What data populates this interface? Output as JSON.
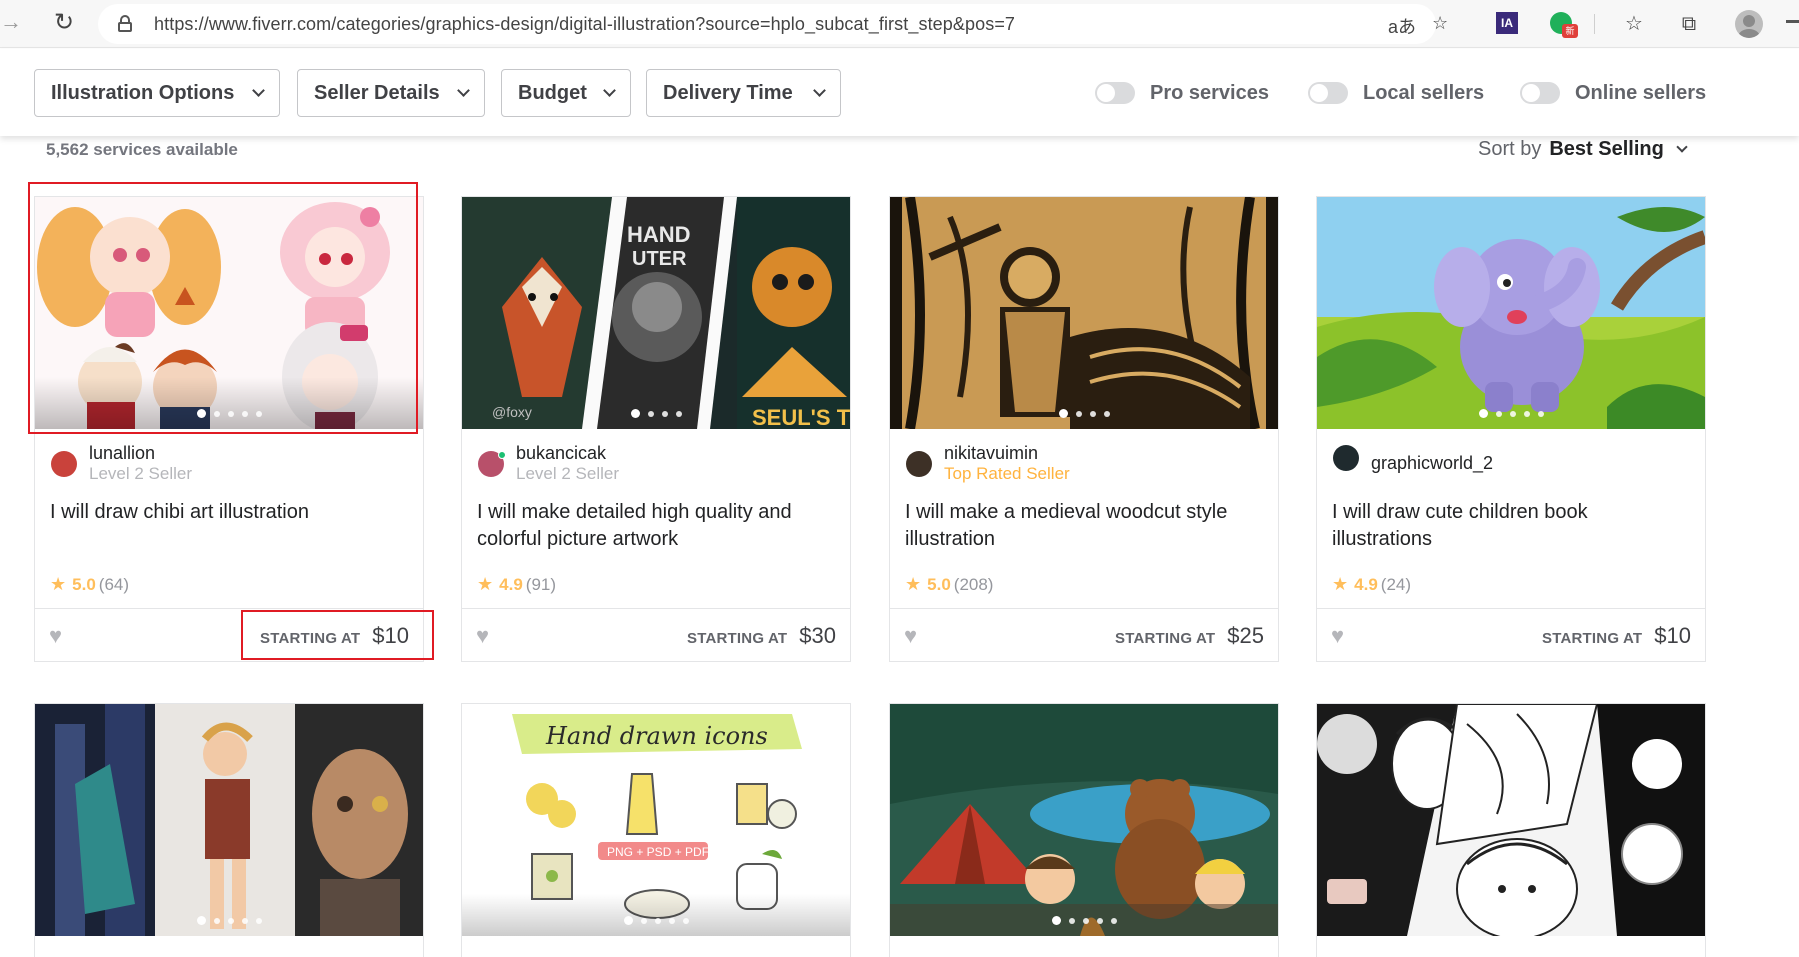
{
  "browser": {
    "url": "https://www.fiverr.com/categories/graphics-design/digital-illustration?source=hplo_subcat_first_step&pos=7",
    "translate_glyph": "aあ",
    "ia_badge": "IA",
    "ext_badge": "新"
  },
  "filters": {
    "dropdowns": [
      "Illustration Options",
      "Seller Details",
      "Budget",
      "Delivery Time"
    ],
    "toggles": [
      "Pro services",
      "Local sellers",
      "Online sellers"
    ]
  },
  "results": {
    "count_text": "5,562 services available",
    "sort_label": "Sort by",
    "sort_value": "Best Selling"
  },
  "price_label": "STARTING AT",
  "gigs": [
    {
      "seller": "lunallion",
      "level": "Level 2 Seller",
      "title": "I will draw chibi art illustration",
      "rating": "5.0",
      "reviews": "(64)",
      "price": "$10"
    },
    {
      "seller": "bukancicak",
      "level": "Level 2 Seller",
      "title": "I will make detailed high quality and colorful picture artwork",
      "rating": "4.9",
      "reviews": "(91)",
      "price": "$30"
    },
    {
      "seller": "nikitavuimin",
      "level": "Top Rated Seller",
      "title": "I will make a medieval woodcut style illustration",
      "rating": "5.0",
      "reviews": "(208)",
      "price": "$25"
    },
    {
      "seller": "graphicworld_2",
      "level": "",
      "title": "I will draw cute children book illustrations",
      "rating": "4.9",
      "reviews": "(24)",
      "price": "$10"
    }
  ],
  "thumb_texts": {
    "handdrawn": "Hand drawn icons",
    "formats": "PNG + PSD + PDF",
    "fox_tag": "@foxy",
    "poster_top": "HAND\nUTER",
    "poster_bottom": "SEUL'S TO"
  }
}
